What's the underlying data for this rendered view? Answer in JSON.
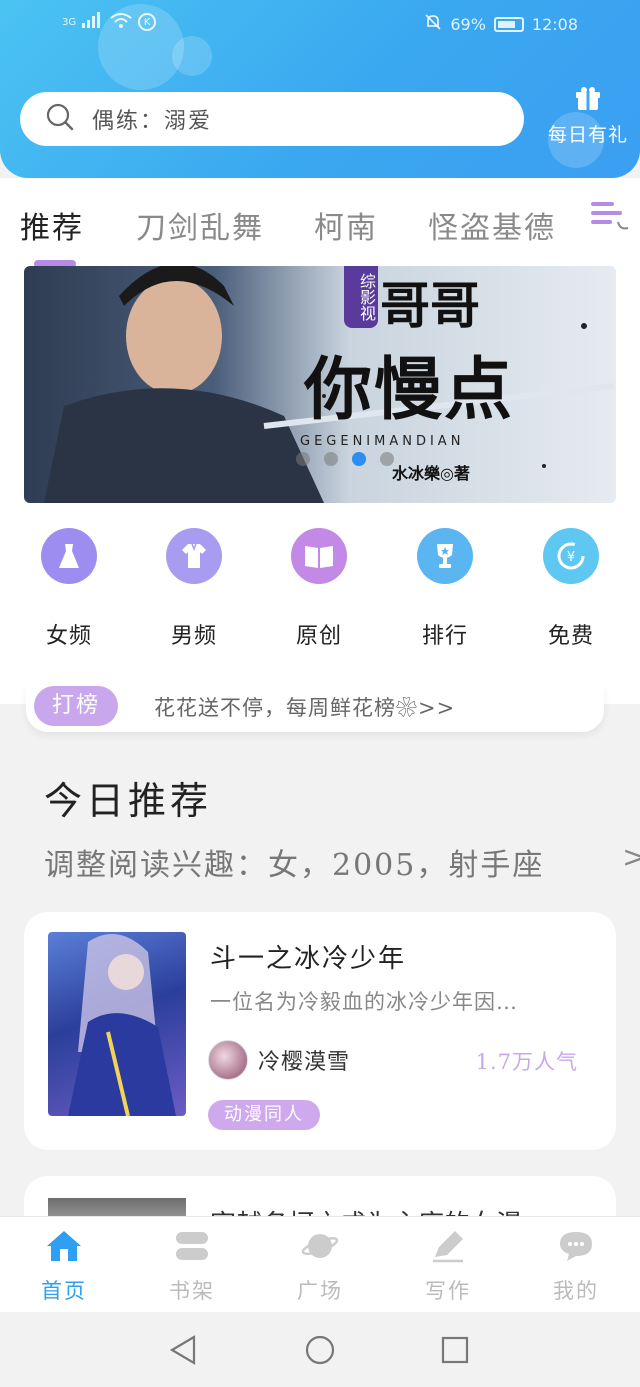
{
  "status_bar": {
    "network": "3G",
    "battery": "69%",
    "time": "12:08",
    "k_badge": "K"
  },
  "search": {
    "placeholder": "偶练：溺爱",
    "icon": "search-icon"
  },
  "daily_gift": {
    "label": "每日有礼",
    "icon": "gift-icon"
  },
  "tabs": [
    {
      "label": "推荐",
      "active": true
    },
    {
      "label": "刀剑乱舞",
      "active": false
    },
    {
      "label": "柯南",
      "active": false
    },
    {
      "label": "怪盗基德",
      "active": false
    }
  ],
  "banner": {
    "tag": "综影视",
    "title_top": "哥哥",
    "title_main": "你慢点",
    "subtitle": "GEGENIMANDIAN",
    "author": "水冰樂◎著",
    "dots": 4,
    "active_dot": 2
  },
  "categories": [
    {
      "label": "女频",
      "icon": "dress-icon",
      "color": "#9d8df0"
    },
    {
      "label": "男频",
      "icon": "shirt-icon",
      "color": "#9d8df0"
    },
    {
      "label": "原创",
      "icon": "book-icon",
      "color": "#c28ae6"
    },
    {
      "label": "排行",
      "icon": "trophy-icon",
      "color": "#5ab5f0"
    },
    {
      "label": "免费",
      "icon": "coin-icon",
      "color": "#5ec8f2"
    }
  ],
  "notice": {
    "badge": "打榜",
    "text": "花花送不停，每周鲜花榜❀>>"
  },
  "today": {
    "title": "今日推荐",
    "interest": "调整阅读兴趣：女，2005，射手座",
    "arrow": ">"
  },
  "book": {
    "title": "斗一之冰冷少年",
    "desc": "一位名为冷毅血的冰冷少年因…",
    "author": "冷樱漠雪",
    "popularity": "1.7万人气",
    "tag": "动漫同人"
  },
  "book2": {
    "title": "穿越名柯之成为主席的女漫"
  },
  "bottom_nav": [
    {
      "label": "首页",
      "icon": "home-icon",
      "active": true
    },
    {
      "label": "书架",
      "icon": "bookshelf-icon",
      "active": false
    },
    {
      "label": "广场",
      "icon": "planet-icon",
      "active": false
    },
    {
      "label": "写作",
      "icon": "pen-icon",
      "active": false
    },
    {
      "label": "我的",
      "icon": "chat-icon",
      "active": false
    }
  ],
  "colors": {
    "header": "#3ba9f0",
    "accent": "#2e9ff2",
    "purple": "#c9a7ec"
  }
}
